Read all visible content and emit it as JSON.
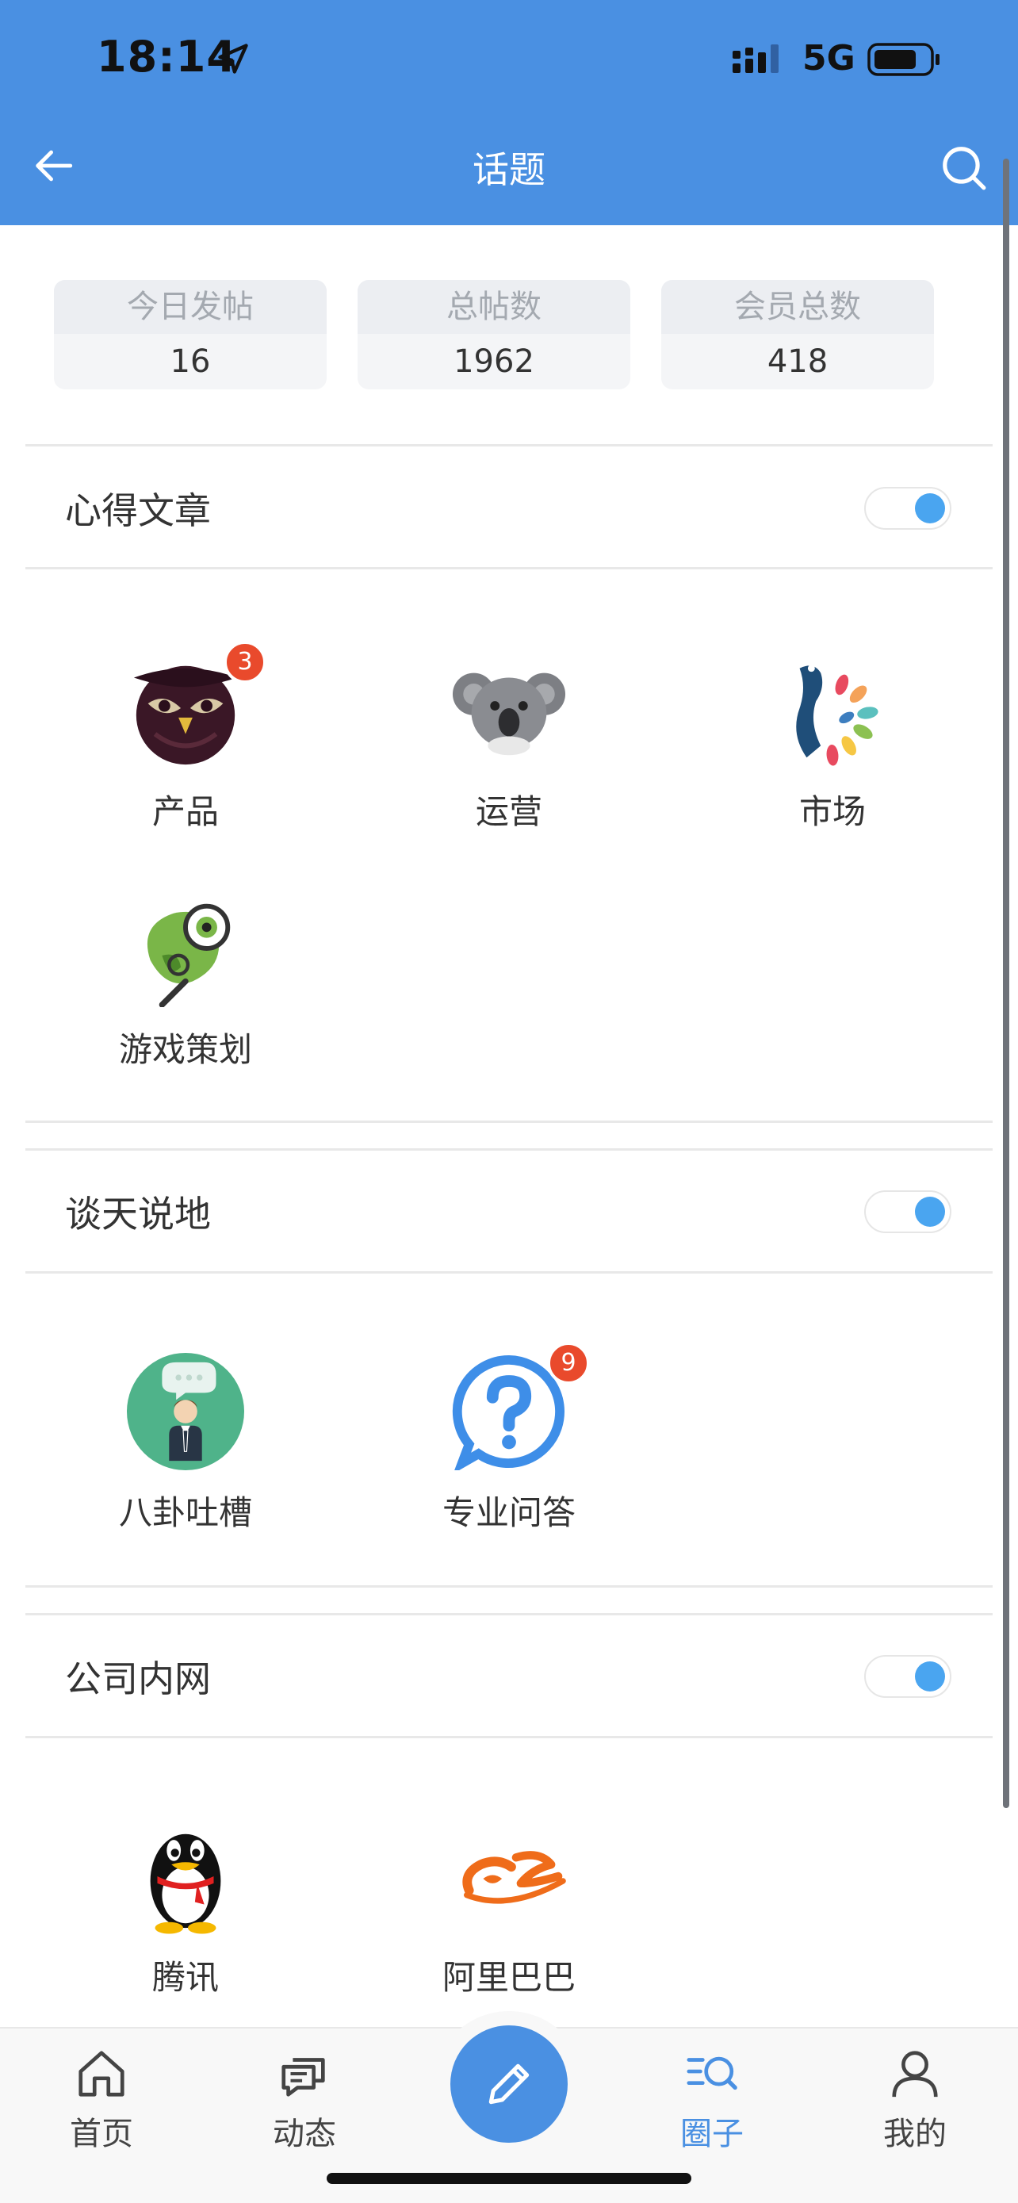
{
  "status_bar": {
    "time": "18:14",
    "network": "5G"
  },
  "nav": {
    "title": "话题"
  },
  "stats": [
    {
      "label": "今日发帖",
      "value": "16"
    },
    {
      "label": "总帖数",
      "value": "1962"
    },
    {
      "label": "会员总数",
      "value": "418"
    }
  ],
  "sections": [
    {
      "title": "心得文章",
      "toggle_on": true,
      "items": [
        {
          "label": "产品",
          "icon": "owl-icon",
          "badge": "3"
        },
        {
          "label": "运营",
          "icon": "koala-icon",
          "badge": ""
        },
        {
          "label": "市场",
          "icon": "peacock-icon",
          "badge": ""
        },
        {
          "label": "游戏策划",
          "icon": "chameleon-icon",
          "badge": ""
        }
      ]
    },
    {
      "title": "谈天说地",
      "toggle_on": true,
      "items": [
        {
          "label": "八卦吐槽",
          "icon": "businessman-icon",
          "badge": ""
        },
        {
          "label": "专业问答",
          "icon": "question-icon",
          "badge": "9"
        }
      ]
    },
    {
      "title": "公司内网",
      "toggle_on": true,
      "items": [
        {
          "label": "腾讯",
          "icon": "penguin-icon",
          "badge": ""
        },
        {
          "label": "阿里巴巴",
          "icon": "alibaba-logo-icon",
          "badge": ""
        }
      ]
    }
  ],
  "tabbar": {
    "items": [
      {
        "label": "首页",
        "icon": "home-icon",
        "active": false
      },
      {
        "label": "动态",
        "icon": "chat-icon",
        "active": false
      },
      {
        "label": "圈子",
        "icon": "circle-search-icon",
        "active": true
      },
      {
        "label": "我的",
        "icon": "user-icon",
        "active": false
      }
    ],
    "compose_icon": "pencil-icon"
  },
  "colors": {
    "primary": "#4a90e2",
    "badge": "#e94a2c",
    "toggle_knob": "#4aa5f0"
  }
}
